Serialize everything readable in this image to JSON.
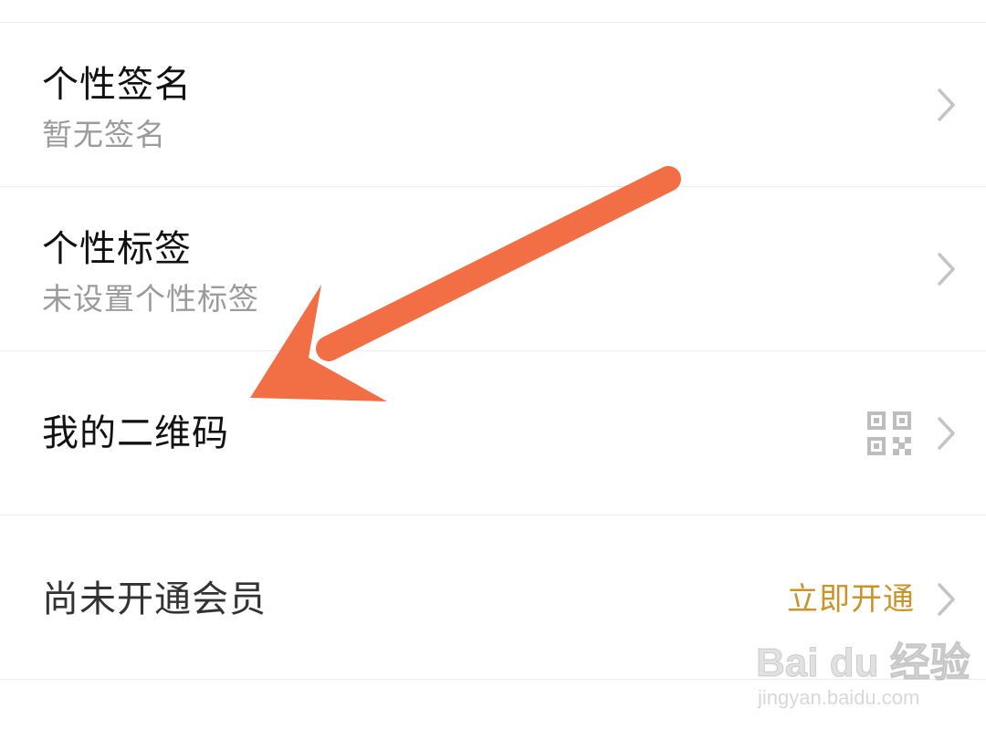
{
  "rows": [
    {
      "title": "个性签名",
      "subtitle": "暂无签名"
    },
    {
      "title": "个性标签",
      "subtitle": "未设置个性标签"
    },
    {
      "title": "我的二维码"
    },
    {
      "title": "尚未开通会员",
      "action": "立即开通"
    }
  ],
  "icons": {
    "chevron": "chevron-right-icon",
    "qr": "qr-code-icon"
  },
  "colors": {
    "divider": "#ededed",
    "subtitle": "#9b9b9b",
    "action": "#c9952b",
    "arrow": "#f26f45"
  },
  "watermark": {
    "logo": "Bai du 经验",
    "url": "jingyan.baidu.com"
  }
}
